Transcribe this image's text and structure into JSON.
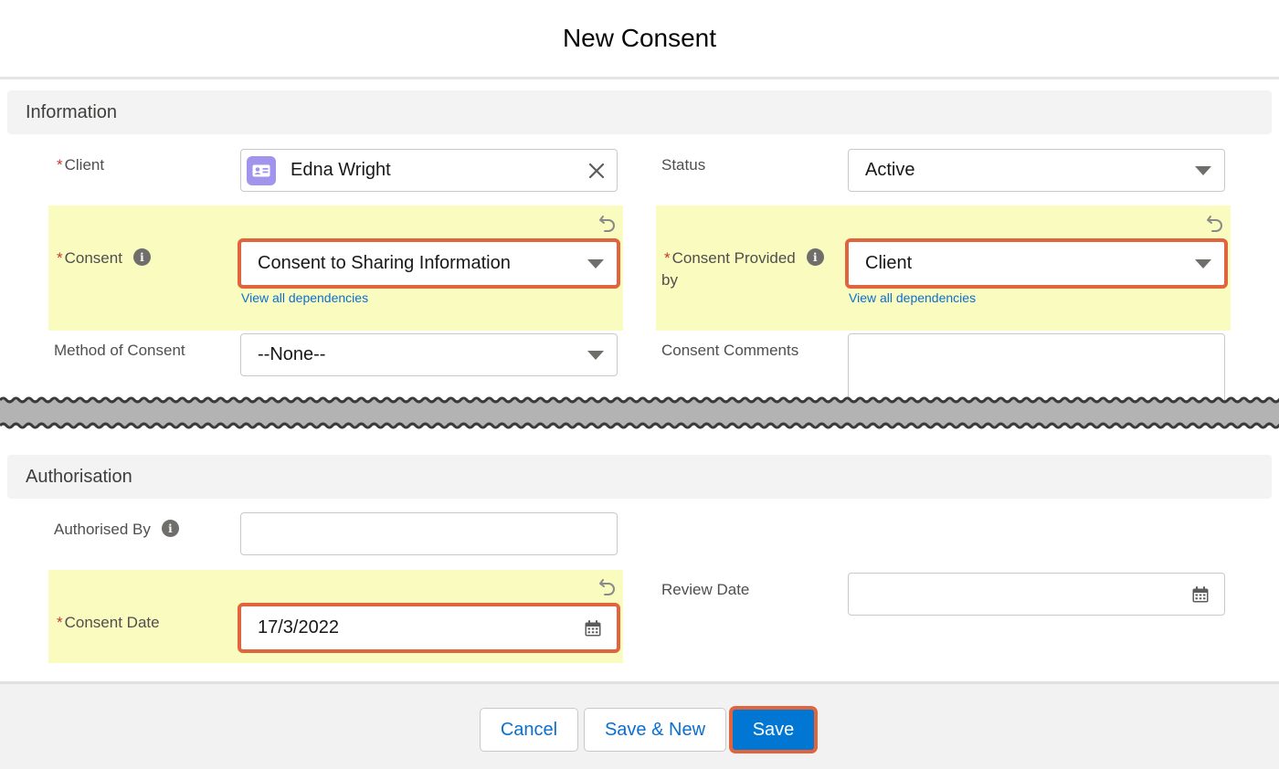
{
  "modal": {
    "title": "New Consent"
  },
  "sections": {
    "information": "Information",
    "authorisation": "Authorisation"
  },
  "fields": {
    "client": {
      "label": "Client",
      "value": "Edna Wright",
      "required": "*"
    },
    "status": {
      "label": "Status",
      "value": "Active"
    },
    "consent": {
      "label": "Consent",
      "value": "Consent to Sharing Information",
      "required": "*",
      "link": "View all dependencies"
    },
    "consent_provided_by": {
      "label_line1": "Consent Provided",
      "label_line2": "by",
      "value": "Client",
      "required": "*",
      "link": "View all dependencies"
    },
    "method_of_consent": {
      "label": "Method of Consent",
      "value": "--None--"
    },
    "consent_comments": {
      "label": "Consent Comments",
      "value": ""
    },
    "authorised_by": {
      "label": "Authorised By",
      "value": ""
    },
    "consent_date": {
      "label": "Consent Date",
      "value": "17/3/2022",
      "required": "*"
    },
    "review_date": {
      "label": "Review Date",
      "value": ""
    }
  },
  "footer": {
    "cancel": "Cancel",
    "save_new": "Save & New",
    "save": "Save"
  },
  "colors": {
    "brand": "#0176d3",
    "highlight_border": "#e0643e",
    "changed_field_bg": "#f9fbbf",
    "link": "#0b6fd0",
    "required": "#c23934"
  },
  "icons": {
    "contact": "contact-card-icon",
    "clear": "close-icon",
    "info": "info-icon",
    "undo": "undo-icon",
    "calendar": "calendar-icon",
    "dropdown": "chevron-down-icon"
  }
}
